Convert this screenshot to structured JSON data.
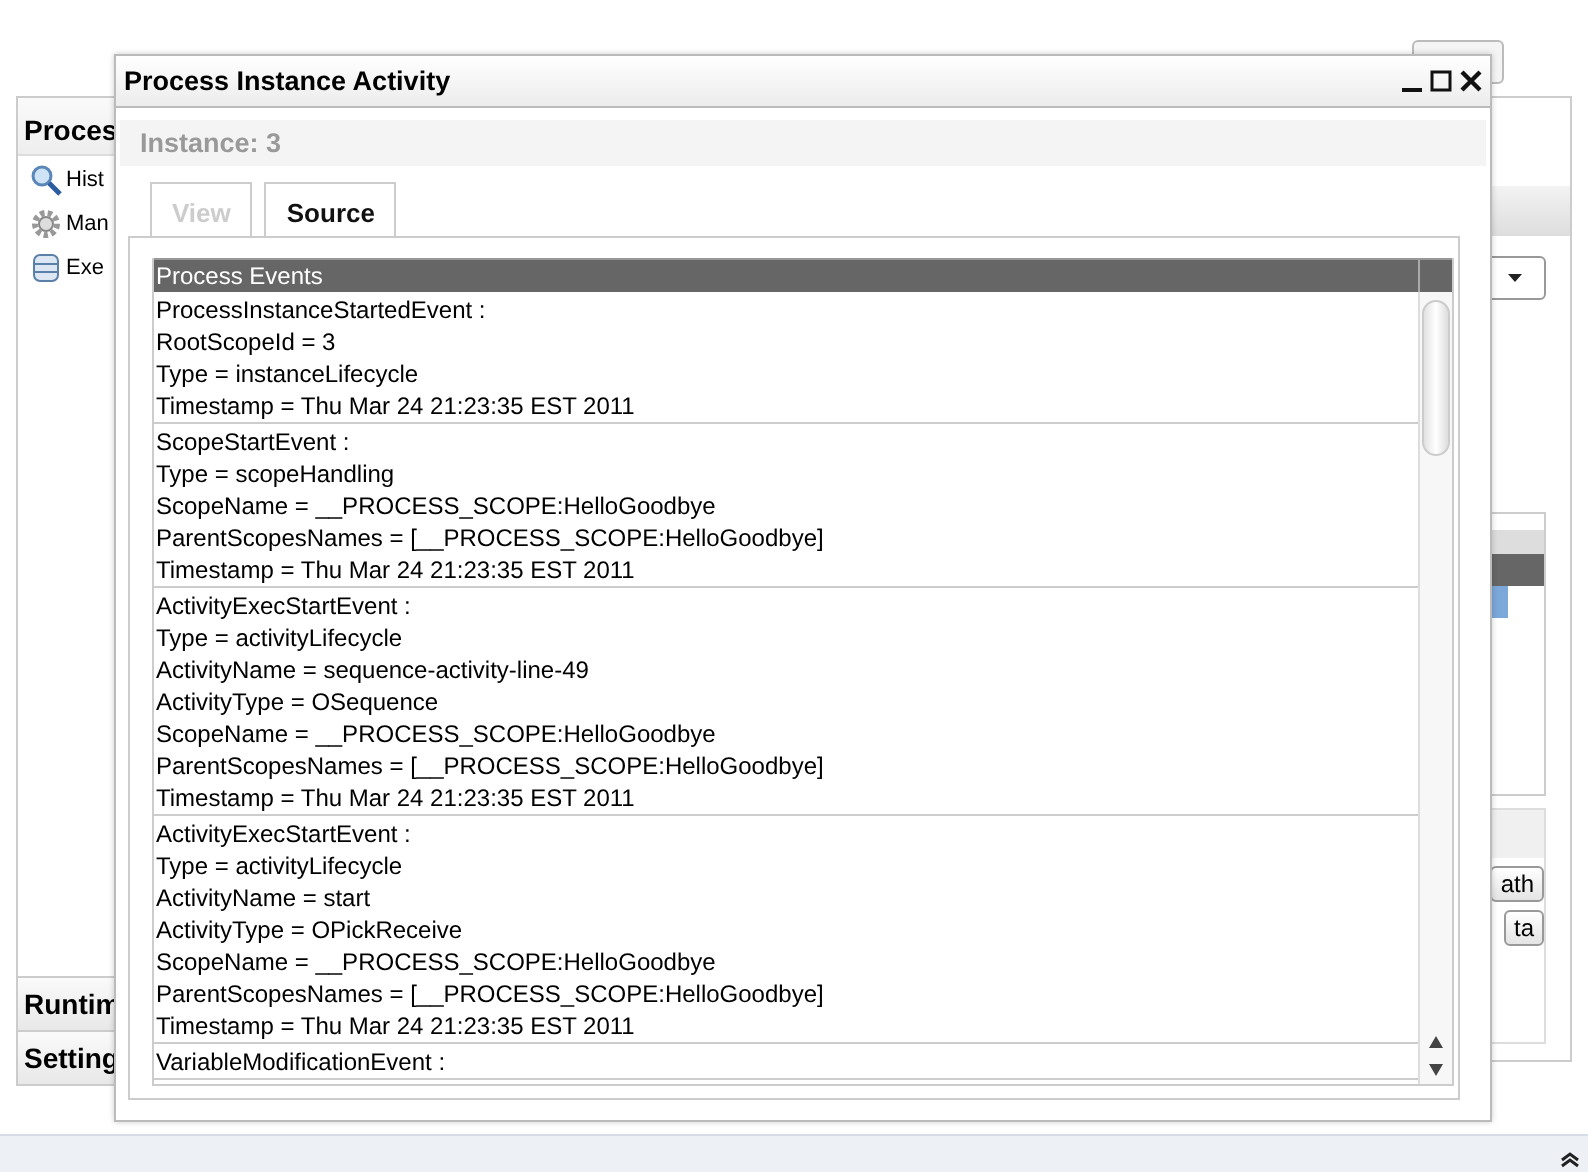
{
  "background": {
    "left_panel": {
      "header": "Proces",
      "items": [
        {
          "label": "Hist"
        },
        {
          "label": "Man"
        },
        {
          "label": "Exe"
        }
      ],
      "sections": [
        "Runtim",
        "Setting"
      ]
    },
    "right_panel": {
      "buttons": [
        "ath",
        "ta"
      ]
    }
  },
  "dialog": {
    "title": "Process Instance Activity",
    "instance": "Instance: 3",
    "tabs": [
      {
        "label": "View",
        "selected": false
      },
      {
        "label": "Source",
        "selected": true
      }
    ],
    "table": {
      "header": "Process Events",
      "events": [
        {
          "lines": [
            "ProcessInstanceStartedEvent :",
            "RootScopeId = 3",
            "Type = instanceLifecycle",
            "Timestamp = Thu Mar 24 21:23:35 EST 2011"
          ]
        },
        {
          "lines": [
            "ScopeStartEvent :",
            "Type = scopeHandling",
            "ScopeName = __PROCESS_SCOPE:HelloGoodbye",
            "ParentScopesNames = [__PROCESS_SCOPE:HelloGoodbye]",
            "Timestamp = Thu Mar 24 21:23:35 EST 2011"
          ]
        },
        {
          "lines": [
            "ActivityExecStartEvent :",
            "Type = activityLifecycle",
            "ActivityName = sequence-activity-line-49",
            "ActivityType = OSequence",
            "ScopeName = __PROCESS_SCOPE:HelloGoodbye",
            "ParentScopesNames = [__PROCESS_SCOPE:HelloGoodbye]",
            "Timestamp = Thu Mar 24 21:23:35 EST 2011"
          ]
        },
        {
          "lines": [
            "ActivityExecStartEvent :",
            "Type = activityLifecycle",
            "ActivityName = start",
            "ActivityType = OPickReceive",
            "ScopeName = __PROCESS_SCOPE:HelloGoodbye",
            "ParentScopesNames = [__PROCESS_SCOPE:HelloGoodbye]",
            "Timestamp = Thu Mar 24 21:23:35 EST 2011"
          ]
        },
        {
          "lines": [
            "VariableModificationEvent :"
          ]
        }
      ]
    }
  }
}
